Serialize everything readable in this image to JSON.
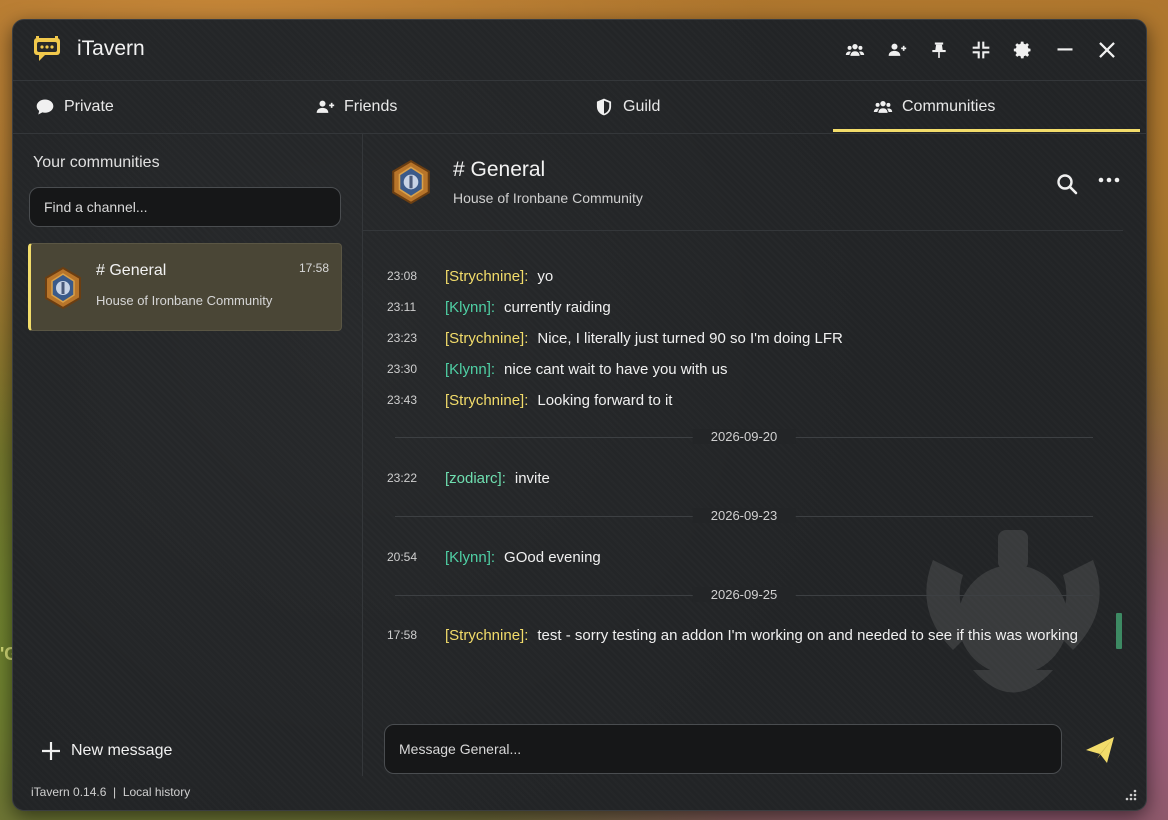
{
  "background": {
    "partial_text": "'G"
  },
  "app": {
    "title": "iTavern",
    "accent": "#f2dc6a"
  },
  "titlebar_icons": [
    "group-icon",
    "add-friend-icon",
    "pin-icon",
    "compress-icon",
    "gear-icon",
    "minimize-icon",
    "close-icon"
  ],
  "tabs": [
    {
      "label": "Private",
      "icon": "speech-bubble-icon"
    },
    {
      "label": "Friends",
      "icon": "add-friend-icon"
    },
    {
      "label": "Guild",
      "icon": "shield-icon"
    },
    {
      "label": "Communities",
      "icon": "group-icon",
      "active": true
    }
  ],
  "sidebar": {
    "heading": "Your communities",
    "search_placeholder": "Find a channel...",
    "items": [
      {
        "name": "# General",
        "subtitle": "House of Ironbane Community",
        "time": "17:58",
        "selected": true
      }
    ],
    "new_message_label": "New message",
    "footer": "iTavern 0.14.6  |  Local history"
  },
  "chat": {
    "title": "# General",
    "subtitle": "House of Ironbane Community",
    "messages": [
      {
        "time": "23:08",
        "author": "[Strychnine]:",
        "text": "yo"
      },
      {
        "time": "23:11",
        "author": "[Klynn]:",
        "text": "currently raiding"
      },
      {
        "time": "23:23",
        "author": "[Strychnine]:",
        "text": "Nice, I literally just turned 90 so I'm doing LFR"
      },
      {
        "time": "23:30",
        "author": "[Klynn]:",
        "text": "nice cant wait to have you with us"
      },
      {
        "time": "23:43",
        "author": "[Strychnine]:",
        "text": "Looking forward to it"
      },
      {
        "date": "2026-09-20"
      },
      {
        "time": "23:22",
        "author": "[zodiarc]:",
        "text": "invite"
      },
      {
        "date": "2026-09-23"
      },
      {
        "time": "20:54",
        "author": "[Klynn]:",
        "text": "GOod evening"
      },
      {
        "date": "2026-09-25"
      },
      {
        "time": "17:58",
        "author": "[Strychnine]:",
        "text": "test - sorry testing an addon I'm working on and needed to see if this was working"
      }
    ],
    "composer_placeholder": "Message General..."
  }
}
